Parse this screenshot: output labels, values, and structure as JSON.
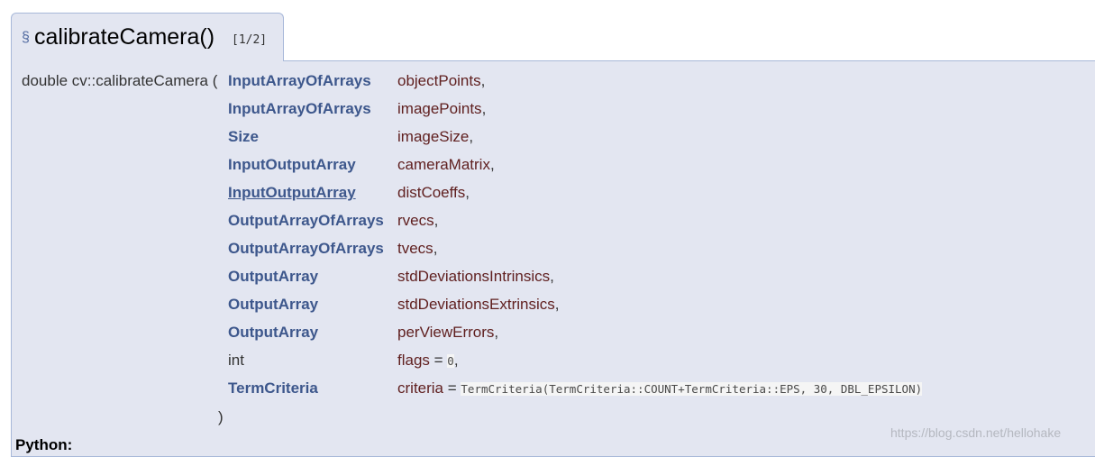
{
  "tab": {
    "section_symbol": "§",
    "function_name": "calibrateCamera()",
    "overload": "[1/2]"
  },
  "signature": {
    "return_type": "double",
    "qualified_name": "cv::calibrateCamera",
    "open_paren": "(",
    "close_paren": ")",
    "params": [
      {
        "type": "InputArrayOfArrays",
        "name": "objectPoints",
        "suffix": ","
      },
      {
        "type": "InputArrayOfArrays",
        "name": "imagePoints",
        "suffix": ","
      },
      {
        "type": "Size",
        "name": "imageSize",
        "suffix": ","
      },
      {
        "type": "InputOutputArray",
        "name": "cameraMatrix",
        "suffix": ","
      },
      {
        "type": "InputOutputArray",
        "name": "distCoeffs",
        "suffix": ","
      },
      {
        "type": "OutputArrayOfArrays",
        "name": "rvecs",
        "suffix": ","
      },
      {
        "type": "OutputArrayOfArrays",
        "name": "tvecs",
        "suffix": ","
      },
      {
        "type": "OutputArray",
        "name": "stdDeviationsIntrinsics",
        "suffix": ","
      },
      {
        "type": "OutputArray",
        "name": "stdDeviationsExtrinsics",
        "suffix": ","
      },
      {
        "type": "OutputArray",
        "name": "perViewErrors",
        "suffix": ","
      },
      {
        "type": "int",
        "name": "flags",
        "default_sep": " = ",
        "default": "0",
        "suffix": ","
      },
      {
        "type": "TermCriteria",
        "name": "criteria",
        "default_sep": " = ",
        "default": "TermCriteria(TermCriteria::COUNT+TermCriteria::EPS, 30, DBL_EPSILON)",
        "suffix": ""
      }
    ]
  },
  "python_label": "Python:",
  "watermark": "https://blog.csdn.net/hellohake"
}
